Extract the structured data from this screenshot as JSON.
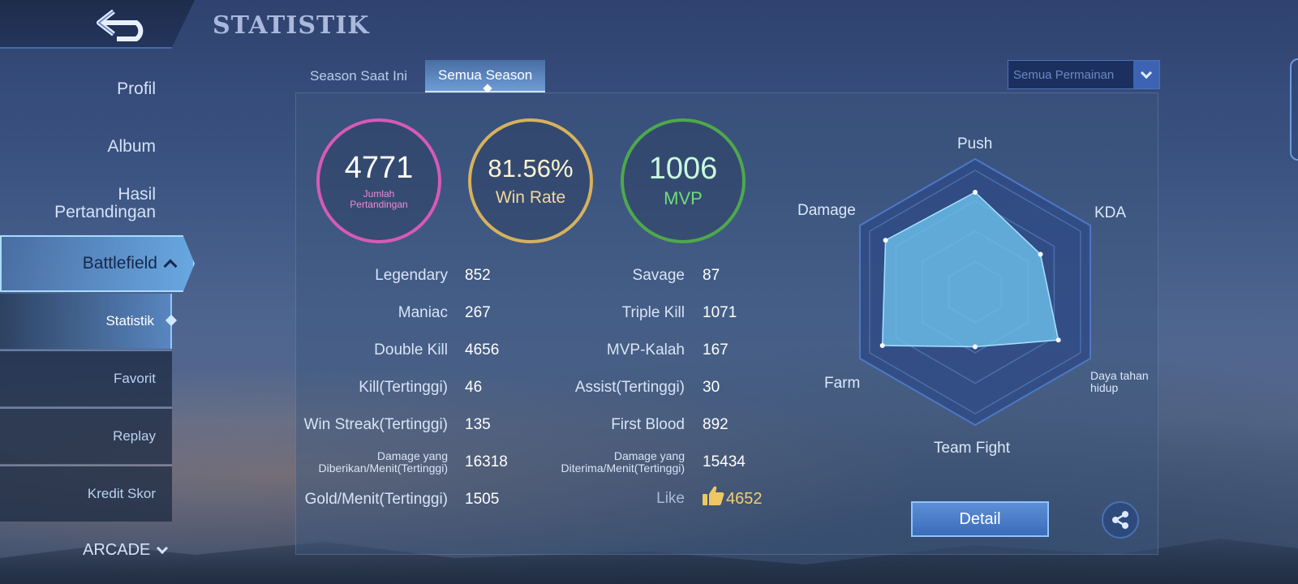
{
  "header": {
    "title": "STATISTIK"
  },
  "sidebar": {
    "items": [
      {
        "label": "Profil"
      },
      {
        "label": "Album"
      },
      {
        "label": "Hasil Pertandingan"
      },
      {
        "label": "Battlefield"
      }
    ],
    "sub_items": [
      {
        "label": "Statistik",
        "active": true
      },
      {
        "label": "Favorit"
      },
      {
        "label": "Replay"
      },
      {
        "label": "Kredit Skor"
      }
    ],
    "arcade": "ARCADE"
  },
  "tabs": [
    {
      "label": "Season Saat Ini"
    },
    {
      "label": "Semua Season",
      "active": true
    }
  ],
  "filter": {
    "selected": "Semua Permainan"
  },
  "summary": {
    "matches": {
      "value": "4771",
      "label": "Jumlah Pertandingan"
    },
    "win_rate": {
      "value": "81.56%",
      "label": "Win Rate"
    },
    "mvp": {
      "value": "1006",
      "label": "MVP"
    }
  },
  "stats_left": [
    {
      "label": "Legendary",
      "value": "852"
    },
    {
      "label": "Maniac",
      "value": "267"
    },
    {
      "label": "Double Kill",
      "value": "4656"
    },
    {
      "label": "Kill(Tertinggi)",
      "value": "46"
    },
    {
      "label": "Win Streak(Tertinggi)",
      "value": "135"
    },
    {
      "label": "Damage yang Diberikan/Menit(Tertinggi)",
      "value": "16318"
    },
    {
      "label": "Gold/Menit(Tertinggi)",
      "value": "1505"
    }
  ],
  "stats_right": [
    {
      "label": "Savage",
      "value": "87"
    },
    {
      "label": "Triple Kill",
      "value": "1071"
    },
    {
      "label": "MVP-Kalah",
      "value": "167"
    },
    {
      "label": "Assist(Tertinggi)",
      "value": "30"
    },
    {
      "label": "First Blood",
      "value": "892"
    },
    {
      "label": "Damage yang Diterima/Menit(Tertinggi)",
      "value": "15434"
    }
  ],
  "like": {
    "label": "Like",
    "value": "4652"
  },
  "radar": {
    "axes": [
      "Push",
      "KDA",
      "Daya tahan hidup",
      "Team Fight",
      "Farm",
      "Damage"
    ],
    "values": [
      0.82,
      0.62,
      0.79,
      0.45,
      0.88,
      0.85
    ],
    "fill_color": "#6ec4f0"
  },
  "buttons": {
    "detail": "Detail"
  },
  "colors": {
    "pink": "#d65ab8",
    "gold": "#d6b25e",
    "green": "#4ea84c"
  }
}
